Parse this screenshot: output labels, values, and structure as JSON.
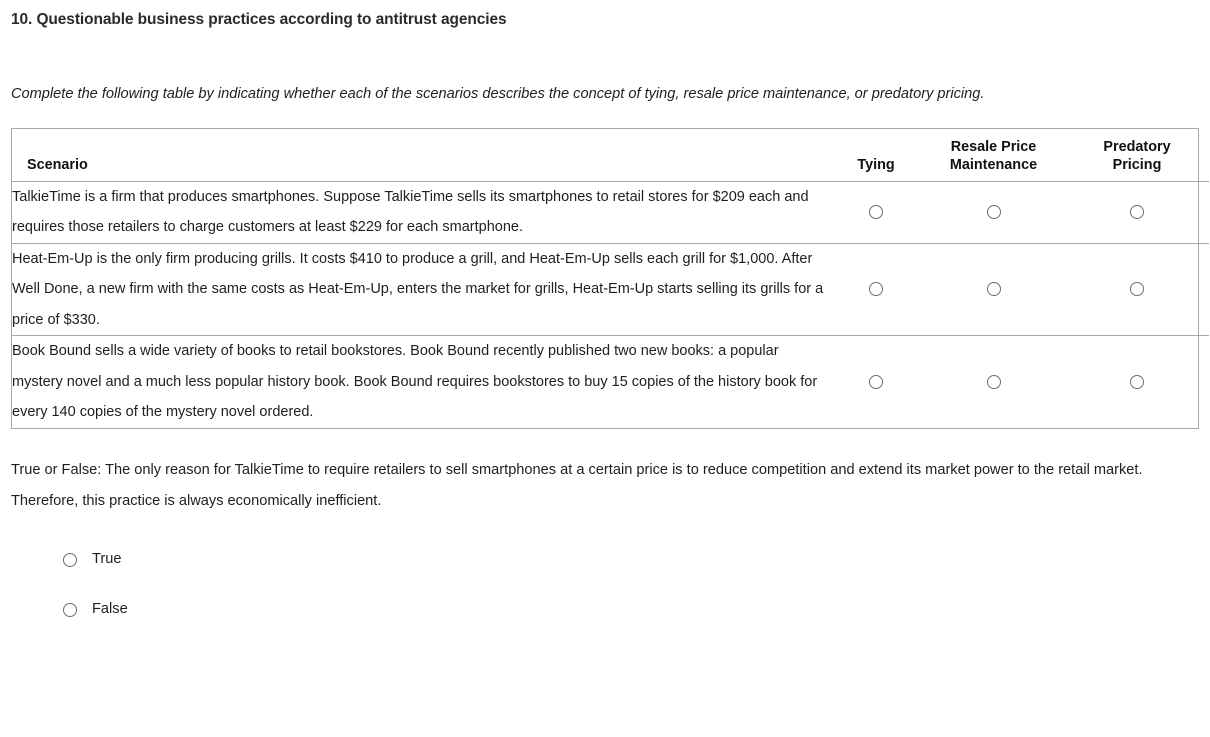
{
  "question": {
    "number_and_title": "10. Questionable business practices according to antitrust agencies",
    "instruction": "Complete the following table by indicating whether each of the scenarios describes the concept of tying, resale price maintenance, or predatory pricing."
  },
  "table": {
    "headers": {
      "scenario": "Scenario",
      "tying": "Tying",
      "resale_price_maintenance_line1": "Resale Price",
      "resale_price_maintenance_line2": "Maintenance",
      "predatory_pricing_line1": "Predatory",
      "predatory_pricing_line2": "Pricing"
    },
    "rows": [
      {
        "scenario": "TalkieTime is a firm that produces smartphones. Suppose TalkieTime sells its smartphones to retail stores for $209 each and requires those retailers to charge customers at least $229 for each smartphone.",
        "tying_selected": false,
        "rpm_selected": false,
        "predatory_selected": false
      },
      {
        "scenario": "Heat-Em-Up is the only firm producing grills. It costs $410 to produce a grill, and Heat-Em-Up sells each grill for $1,000. After Well Done, a new firm with the same costs as Heat-Em-Up, enters the market for grills, Heat-Em-Up starts selling its grills for a price of $330.",
        "tying_selected": false,
        "rpm_selected": false,
        "predatory_selected": false
      },
      {
        "scenario": "Book Bound sells a wide variety of books to retail bookstores. Book Bound recently published two new books: a popular mystery novel and a much less popular history book. Book Bound requires bookstores to buy 15 copies of the history book for every 140 copies of the mystery novel ordered.",
        "tying_selected": false,
        "rpm_selected": false,
        "predatory_selected": false
      }
    ]
  },
  "true_false": {
    "statement": "True or False: The only reason for TalkieTime to require retailers to sell smartphones at a certain price is to reduce competition and extend its market power to the retail market. Therefore, this practice is always economically inefficient.",
    "options": [
      {
        "label": "True",
        "selected": false
      },
      {
        "label": "False",
        "selected": false
      }
    ]
  },
  "colors": {
    "text": "#1f1f1f",
    "heading": "#2b2b2b",
    "border": "#a9a9a9",
    "radio_border": "#6e6e6e",
    "background": "#ffffff"
  }
}
